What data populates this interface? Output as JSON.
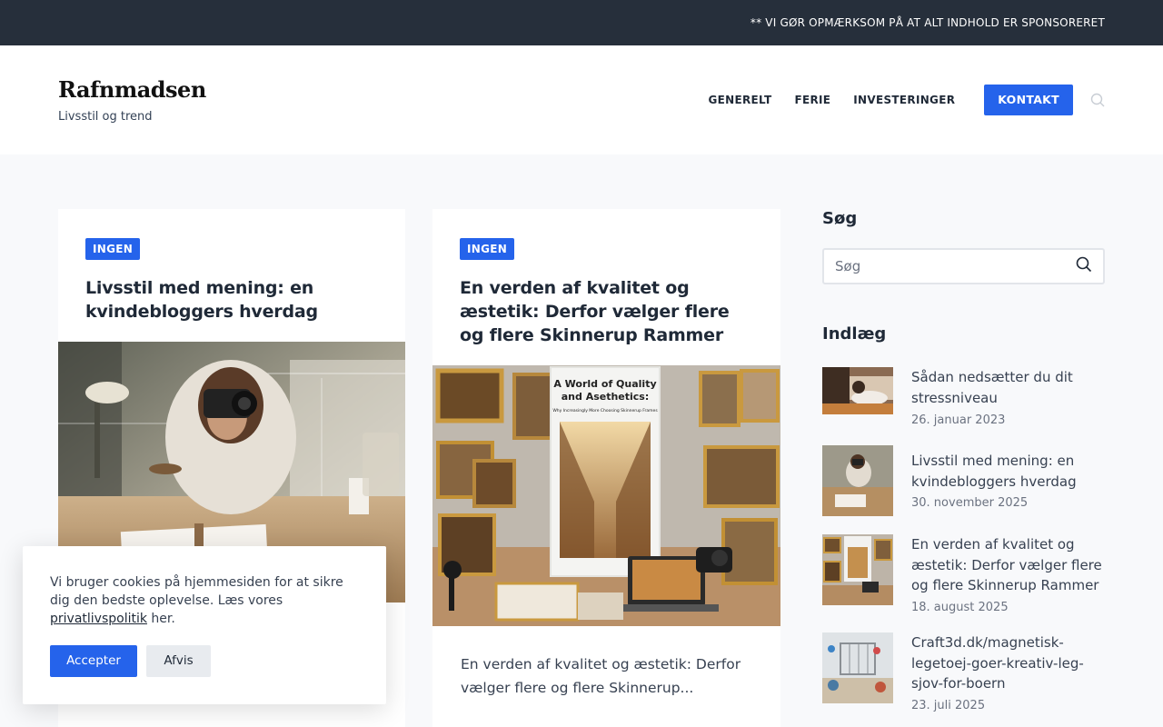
{
  "topbar": {
    "notice": "** VI GØR OPMÆRKSOM PÅ AT ALT INDHOLD ER SPONSORERET"
  },
  "brand": {
    "title": "Rafnmadsen",
    "tagline": "Livsstil og trend"
  },
  "nav": {
    "items": [
      "GENERELT",
      "FERIE",
      "INVESTERINGER"
    ],
    "cta": "KONTAKT",
    "search_icon": "search-icon"
  },
  "posts": [
    {
      "category": "INGEN",
      "title": "Livsstil med mening: en kvindebloggers hverdag",
      "image": "woman-photographer-desk-photo"
    },
    {
      "category": "INGEN",
      "title": "En verden af kvalitet og æstetik: Derfor vælger flere og flere Skinnerup Rammer",
      "image": "picture-frames-collage-photo",
      "image_text_1": "A World of Quality",
      "image_text_2": "and Asethetics:",
      "image_text_3": "Why Increasingly More Choosing Skinnerup Frames",
      "excerpt": "En verden af kvalitet og æstetik: Derfor vælger flere og flere Skinnerup..."
    }
  ],
  "sidebar": {
    "search_heading": "Søg",
    "search_placeholder": "Søg",
    "posts_heading": "Indlæg",
    "recent": [
      {
        "title": "Sådan nedsætter du dit stressniveau",
        "date": "26. januar 2023"
      },
      {
        "title": "Livsstil med mening: en kvindebloggers hverdag",
        "date": "30. november 2025"
      },
      {
        "title": "En verden af kvalitet og æstetik: Derfor vælger flere og flere Skinnerup Rammer",
        "date": "18. august 2025"
      },
      {
        "title": "Craft3d.dk/magnetisk-legetoej-goer-kreativ-leg-sjov-for-boern",
        "date": "23. juli 2025"
      }
    ]
  },
  "cookie": {
    "text_before": "Vi bruger cookies på hjemmesiden for at sikre dig den bedste oplevelse. Læs vores ",
    "link": "privatlivspolitik",
    "text_after": " her.",
    "accept": "Accepter",
    "decline": "Afvis"
  },
  "colors": {
    "accent": "#2563eb",
    "topbar": "#262f3b",
    "background": "#f8f9fb"
  }
}
